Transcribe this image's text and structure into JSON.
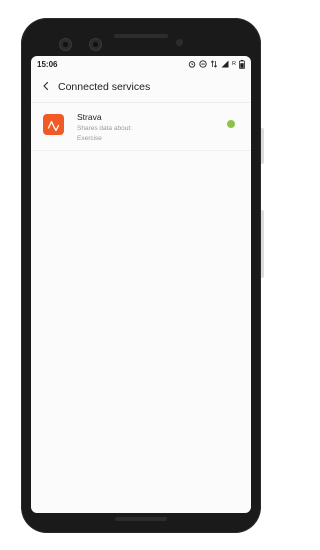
{
  "status_bar": {
    "time": "15:06",
    "r_indicator": "R",
    "icons": [
      "alarm-icon",
      "dnd-icon",
      "data-arrows-icon",
      "signal-icon",
      "battery-icon"
    ]
  },
  "header": {
    "back_icon": "chevron-left-icon",
    "title": "Connected services"
  },
  "services": [
    {
      "name": "Strava",
      "desc_line1": "Shares data about:",
      "desc_line2": "Exercise",
      "icon": "strava-logo-icon",
      "icon_color": "#f15a24",
      "status_color": "#8bc34a",
      "connected": true
    }
  ]
}
